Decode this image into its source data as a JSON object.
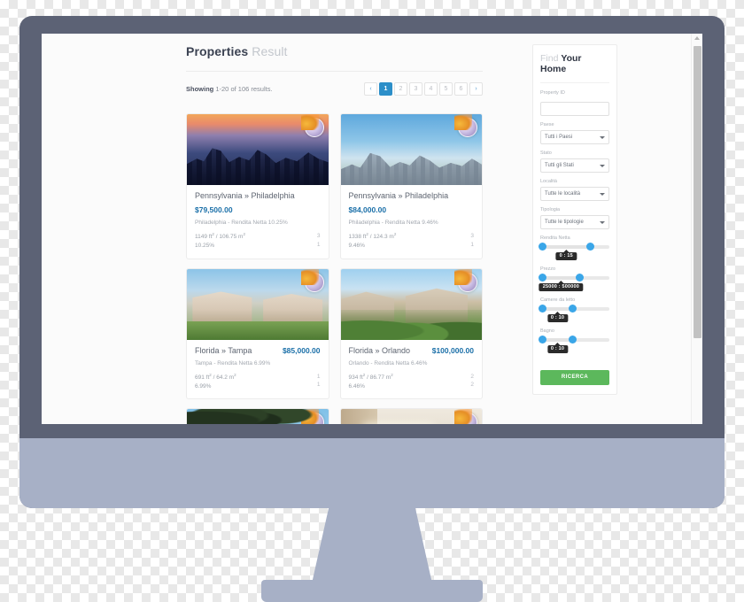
{
  "device": {
    "kind": "desktop-monitor",
    "bezel_color": "#5c6275",
    "stand_color": "#a7b0c6"
  },
  "page": {
    "title_strong": "Properties",
    "title_muted": "Result",
    "showing_label": "Showing",
    "showing_text": "1-20 of 106 results."
  },
  "pagination": {
    "prev_icon": "chevron-left-icon",
    "next_icon": "chevron-right-icon",
    "prev_label": "‹",
    "next_label": "›",
    "pages": [
      "1",
      "2",
      "3",
      "4",
      "5",
      "6"
    ],
    "active": "1",
    "active_color": "#2c8fc9"
  },
  "cards": [
    {
      "location": "Pennsylvania » Philadelphia",
      "price": "$79,500.00",
      "subtitle": "Philadelphia - Rendita Netta 10.25%",
      "area_ft": "1149 ft",
      "area_m": "/ 106.75 m",
      "yield": "10.25%",
      "beds": "3",
      "baths": "1",
      "photo": "philadelphia-skyline-dusk"
    },
    {
      "location": "Pennsylvania » Philadelphia",
      "price": "$84,000.00",
      "subtitle": "Philadelphia - Rendita Netta 9.46%",
      "area_ft": "1338 ft",
      "area_m": "/ 124.3 m",
      "yield": "9.46%",
      "beds": "3",
      "baths": "1",
      "photo": "philadelphia-skyline-day"
    },
    {
      "location": "Florida » Tampa",
      "price": "$85,000.00",
      "subtitle": "Tampa - Rendita Netta 6.99%",
      "area_ft": "691 ft",
      "area_m": "/ 64.2 m",
      "yield": "6.99%",
      "beds": "1",
      "baths": "1",
      "photo": "tampa-apartment-building"
    },
    {
      "location": "Florida » Orlando",
      "price": "$100,000.00",
      "subtitle": "Orlando - Rendita Netta 6.46%",
      "area_ft": "934 ft",
      "area_m": "/ 86.77 m",
      "yield": "6.46%",
      "beds": "2",
      "baths": "2",
      "photo": "orlando-house-garden"
    },
    {
      "location": "",
      "price": "",
      "subtitle": "",
      "area_ft": "",
      "area_m": "",
      "yield": "",
      "beds": "",
      "baths": "",
      "photo": "beach-palm-trees"
    },
    {
      "location": "",
      "price": "",
      "subtitle": "",
      "area_ft": "",
      "area_m": "",
      "yield": "",
      "beds": "",
      "baths": "",
      "photo": "interior-hallway"
    }
  ],
  "sidebar": {
    "title_thin": "Find ",
    "title_strong": "Your Home",
    "fields": [
      {
        "label": "Property ID",
        "type": "text",
        "value": "",
        "placeholder": ""
      },
      {
        "label": "Paese",
        "type": "select",
        "value": "Tutti i Paesi"
      },
      {
        "label": "Stato",
        "type": "select",
        "value": "Tutti gli Stati"
      },
      {
        "label": "Località",
        "type": "select",
        "value": "Tutte le località"
      },
      {
        "label": "Tipologia",
        "type": "select",
        "value": "Tutte le tipologie"
      }
    ],
    "sliders": [
      {
        "label": "Rendita Netta",
        "tooltip": "0 : 15",
        "min_pct": 3,
        "max_pct": 72
      },
      {
        "label": "Prezzo",
        "tooltip": "25000 : 500000",
        "min_pct": 3,
        "max_pct": 57
      },
      {
        "label": "Camere da letto",
        "tooltip": "0 : 10",
        "min_pct": 3,
        "max_pct": 47
      },
      {
        "label": "Bagno",
        "tooltip": "0 : 10",
        "min_pct": 3,
        "max_pct": 47
      }
    ],
    "search_button": "RICERCA",
    "search_button_color": "#5cb85c"
  },
  "scrollbar": {
    "position_pct": 3
  }
}
